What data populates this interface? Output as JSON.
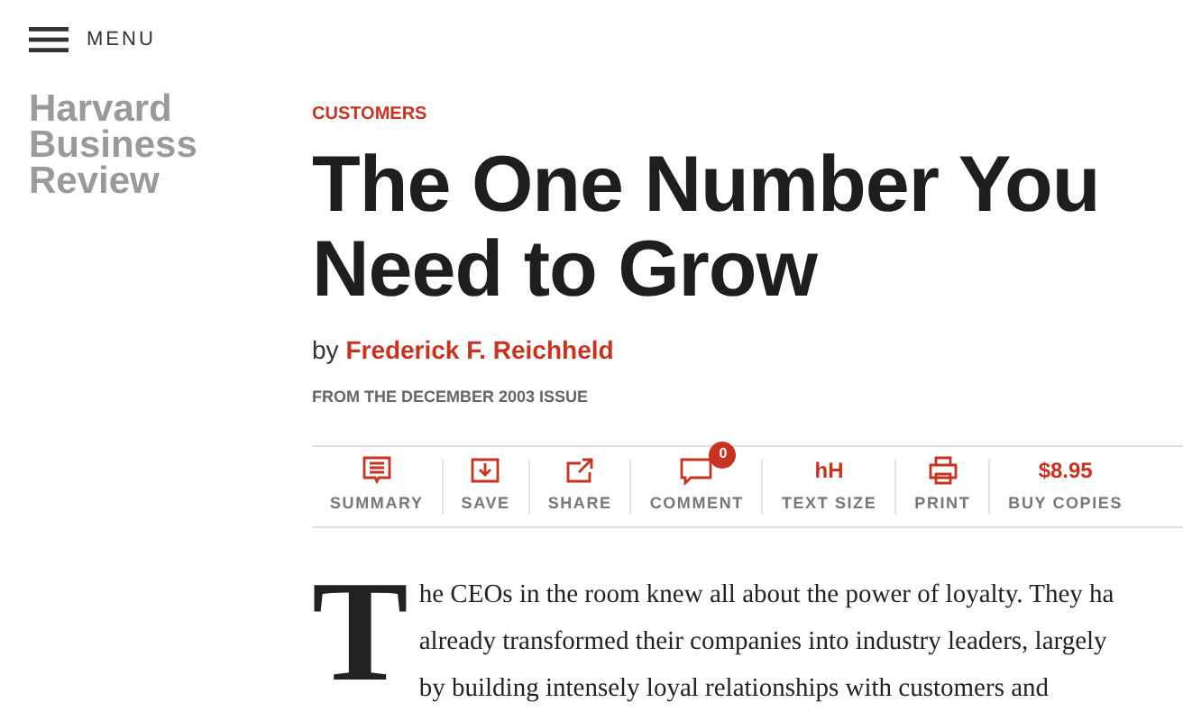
{
  "menu": {
    "label": "MENU"
  },
  "logo": {
    "lines": [
      "Harvard",
      "Business",
      "Review"
    ]
  },
  "article": {
    "category": "CUSTOMERS",
    "title_lines": [
      "The One Number You",
      "Need to Grow"
    ],
    "byline": {
      "prefix": "by",
      "author": "Frederick F. Reichheld"
    },
    "issue": "FROM THE DECEMBER 2003 ISSUE"
  },
  "toolbar": [
    {
      "kind": "summary",
      "label": "SUMMARY"
    },
    {
      "kind": "save",
      "label": "SAVE"
    },
    {
      "kind": "share",
      "label": "SHARE"
    },
    {
      "kind": "comment",
      "label": "COMMENT",
      "badge": "0"
    },
    {
      "kind": "glyph",
      "glyph": "hH",
      "label": "TEXT SIZE"
    },
    {
      "kind": "print",
      "label": "PRINT"
    },
    {
      "kind": "glyph",
      "glyph": "$8.95",
      "label": "BUY COPIES"
    }
  ],
  "body": {
    "drop_cap": "T",
    "lines": [
      "he CEOs in the room knew all about the power of loyalty. They ha",
      "already transformed their companies into industry leaders, largely",
      "by building intensely loyal relationships with customers and"
    ]
  }
}
